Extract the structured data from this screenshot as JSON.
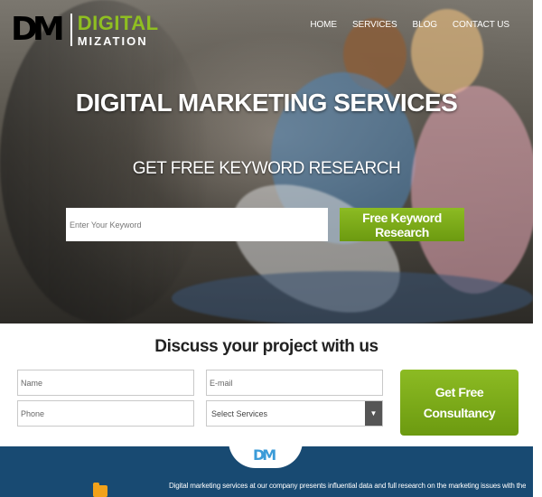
{
  "logo": {
    "mark": "DM",
    "word1": "DIGITAL",
    "word2": "MIZATION"
  },
  "nav": {
    "items": [
      "HOME",
      "SERVICES",
      "BLOG",
      "CONTACT US"
    ]
  },
  "hero": {
    "title": "DIGITAL MARKETING SERVICES",
    "subtitle": "GET FREE KEYWORD RESEARCH",
    "keyword_placeholder": "Enter Your Keyword",
    "keyword_button": "Free Keyword Research"
  },
  "form": {
    "heading": "Discuss your project with us",
    "name_placeholder": "Name",
    "email_placeholder": "E-mail",
    "phone_placeholder": "Phone",
    "service_selected": "Select Services",
    "submit_line1": "Get Free",
    "submit_line2": "Consultancy"
  },
  "footer": {
    "mark": "DM",
    "text": "Digital marketing services at our company presents influential data and full research on the marketing issues with the help of"
  },
  "icons": {
    "dropdown": "chevron-down-icon",
    "folder": "folder-icon"
  },
  "colors": {
    "accent": "#7aa61a",
    "footer_bg": "#184a72",
    "logo_green": "#8fbf21"
  }
}
